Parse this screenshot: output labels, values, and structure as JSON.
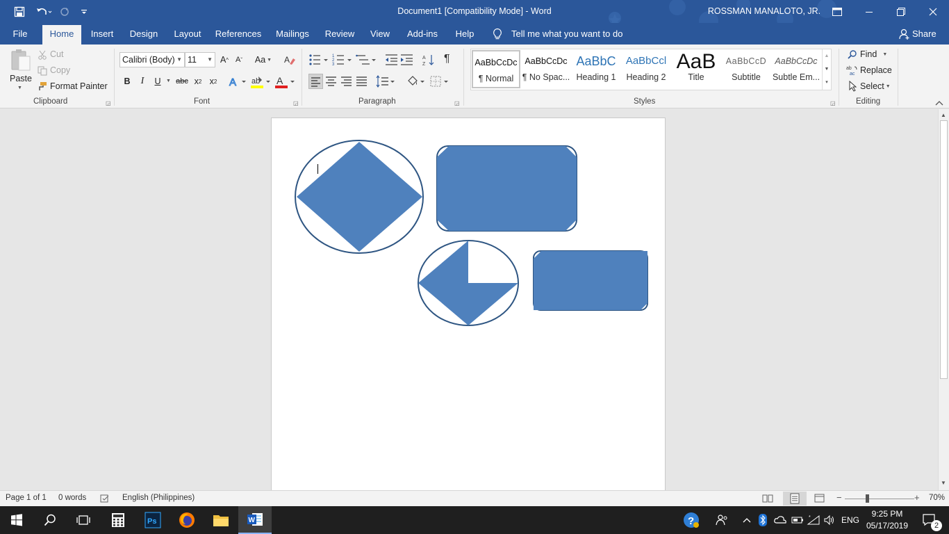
{
  "window": {
    "title": "Document1 [Compatibility Mode]  -  Word",
    "user": "ROSSMAN MANALOTO, JR."
  },
  "tabs": [
    "File",
    "Home",
    "Insert",
    "Design",
    "Layout",
    "References",
    "Mailings",
    "Review",
    "View",
    "Add-ins",
    "Help"
  ],
  "tell_me": "Tell me what you want to do",
  "share": "Share",
  "clipboard": {
    "paste": "Paste",
    "cut": "Cut",
    "copy": "Copy",
    "format_painter": "Format Painter",
    "label": "Clipboard"
  },
  "font": {
    "name": "Calibri (Body)",
    "size": "11",
    "change_case": "Aa",
    "bold": "B",
    "italic": "I",
    "underline": "U",
    "strike": "abc",
    "sub": "x",
    "sup": "x",
    "font_color": "A",
    "label": "Font"
  },
  "paragraph": {
    "label": "Paragraph"
  },
  "styles": {
    "items": [
      {
        "preview": "AaBbCcDc",
        "label": "¶ Normal"
      },
      {
        "preview": "AaBbCcDc",
        "label": "¶ No Spac..."
      },
      {
        "preview": "AaBbC",
        "label": "Heading 1"
      },
      {
        "preview": "AaBbCcl",
        "label": "Heading 2"
      },
      {
        "preview": "AaB",
        "label": "Title"
      },
      {
        "preview": "AaBbCcD",
        "label": "Subtitle"
      },
      {
        "preview": "AaBbCcDc",
        "label": "Subtle Em..."
      }
    ],
    "label": "Styles"
  },
  "editing": {
    "find": "Find",
    "replace": "Replace",
    "select": "Select",
    "label": "Editing"
  },
  "status": {
    "page": "Page 1 of 1",
    "words": "0 words",
    "language": "English (Philippines)",
    "zoom": "70%"
  },
  "taskbar": {
    "lang": "ENG",
    "time": "9:25 PM",
    "date": "05/17/2019",
    "notifications": "2"
  },
  "colors": {
    "word_blue": "#2b579a",
    "shape_fill": "#4f81bd",
    "shape_stroke": "#2e5582",
    "taskbar": "#1f1f1f"
  }
}
